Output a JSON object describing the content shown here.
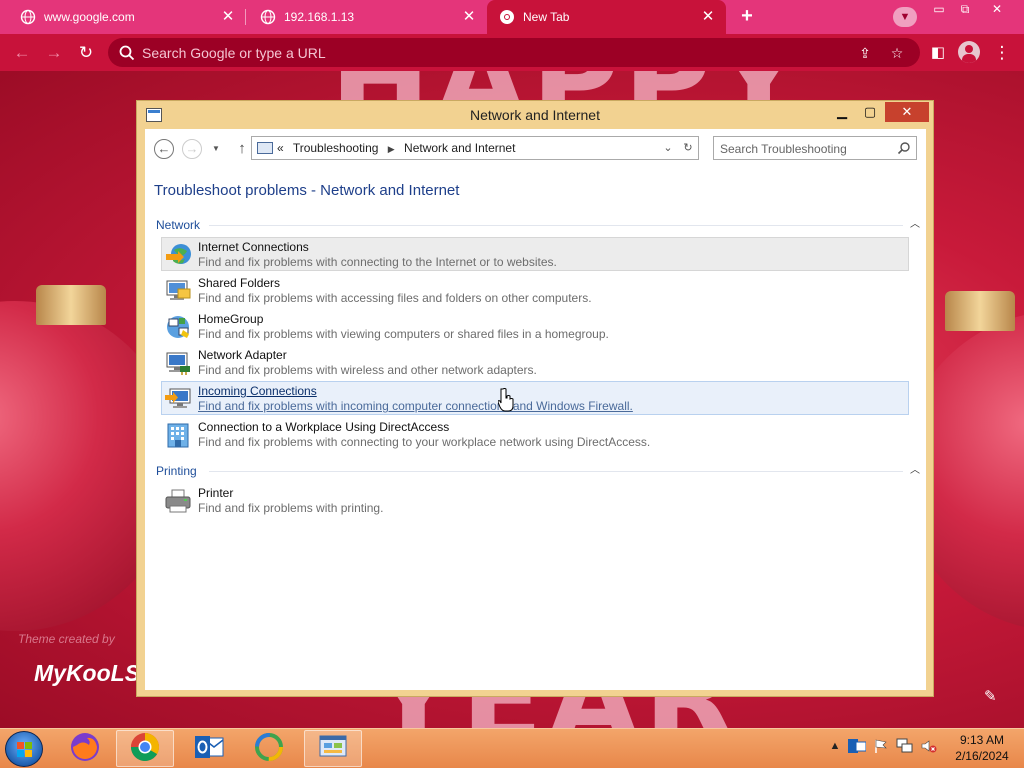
{
  "browser": {
    "tabs": [
      {
        "label": "www.google.com"
      },
      {
        "label": "192.168.1.13"
      },
      {
        "label": "New Tab"
      }
    ],
    "new_tab_label": "+",
    "omnibox_placeholder": "Search Google or type a URL"
  },
  "background": {
    "credit_text": "Theme created by",
    "brand_text": "MyKooLS"
  },
  "window": {
    "title": "Network and Internet",
    "breadcrumb_prefix": "«",
    "breadcrumbs": [
      "Troubleshooting",
      "Network and Internet"
    ],
    "search_placeholder": "Search Troubleshooting",
    "heading": "Troubleshoot problems - Network and Internet",
    "groups": [
      {
        "label": "Network",
        "items": [
          {
            "name": "Internet Connections",
            "desc": "Find and fix problems with connecting to the Internet or to websites.",
            "icon": "internet-connections-icon"
          },
          {
            "name": "Shared Folders",
            "desc": "Find and fix problems with accessing files and folders on other computers.",
            "icon": "shared-folders-icon"
          },
          {
            "name": "HomeGroup",
            "desc": "Find and fix problems with viewing computers or shared files in a homegroup.",
            "icon": "homegroup-icon"
          },
          {
            "name": "Network Adapter",
            "desc": "Find and fix problems with wireless and other network adapters.",
            "icon": "network-adapter-icon"
          },
          {
            "name": "Incoming Connections",
            "desc": "Find and fix problems with incoming computer connections and Windows Firewall.",
            "icon": "incoming-connections-icon"
          },
          {
            "name": "Connection to a Workplace Using DirectAccess",
            "desc": "Find and fix problems with connecting to your workplace network using DirectAccess.",
            "icon": "directaccess-icon"
          }
        ]
      },
      {
        "label": "Printing",
        "items": [
          {
            "name": "Printer",
            "desc": "Find and fix problems with printing.",
            "icon": "printer-icon"
          }
        ]
      }
    ]
  },
  "taskbar": {
    "apps": [
      "firefox-icon",
      "chrome-icon",
      "outlook-icon",
      "windows-live-icon",
      "control-panel-icon"
    ],
    "clock_time": "9:13 AM",
    "clock_date": "2/16/2024"
  },
  "colors": {
    "tab_strip": "#e4357a",
    "toolbar": "#c8123a",
    "window_frame": "#f2d291",
    "heading": "#1e3f8a",
    "taskbar": "#e8874a"
  }
}
